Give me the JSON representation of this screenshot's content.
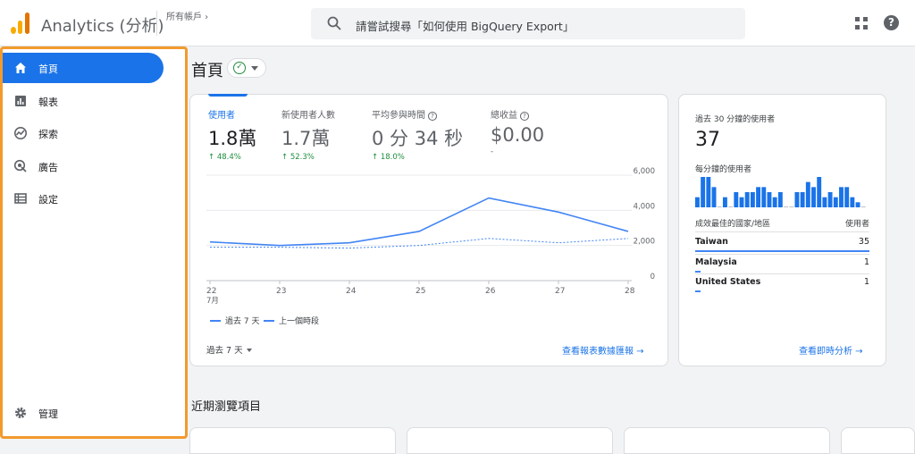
{
  "app": {
    "title": "Analytics (分析)",
    "account_breadcrumb": "所有帳戶 ›"
  },
  "search": {
    "placeholder": "請嘗試搜尋「如何使用 BigQuery Export」"
  },
  "sidebar": {
    "items": [
      {
        "label": "首頁",
        "icon": "home-icon",
        "active": true
      },
      {
        "label": "報表",
        "icon": "reports-icon",
        "active": false
      },
      {
        "label": "探索",
        "icon": "explore-icon",
        "active": false
      },
      {
        "label": "廣告",
        "icon": "advertising-icon",
        "active": false
      },
      {
        "label": "設定",
        "icon": "configure-icon",
        "active": false
      }
    ],
    "admin_label": "管理"
  },
  "page": {
    "title": "首頁",
    "recent_title": "近期瀏覽項目"
  },
  "metrics": [
    {
      "label": "使用者",
      "value": "1.8萬",
      "delta": "↑ 48.4%",
      "selected": true,
      "help": false
    },
    {
      "label": "新使用者人數",
      "value": "1.7萬",
      "delta": "↑ 52.3%",
      "selected": false,
      "help": false
    },
    {
      "label": "平均參與時間",
      "value": "0 分 34 秒",
      "delta": "↑ 18.0%",
      "selected": false,
      "help": true
    },
    {
      "label": "總收益",
      "value": "$0.00",
      "delta": "-",
      "selected": false,
      "help": true
    }
  ],
  "chart_data": {
    "type": "line",
    "categories": [
      "22",
      "23",
      "24",
      "25",
      "26",
      "27",
      "28"
    ],
    "x_month_label": "7月",
    "yticks": [
      "6,000",
      "4,000",
      "2,000",
      "0"
    ],
    "ylim": [
      0,
      6000
    ],
    "series": [
      {
        "name": "過去 7 天",
        "style": "solid",
        "values": [
          2200,
          2000,
          2150,
          2800,
          4700,
          3900,
          2800
        ]
      },
      {
        "name": "上一個時段",
        "style": "dashed",
        "values": [
          1900,
          1900,
          1850,
          2000,
          2400,
          2150,
          2400
        ]
      }
    ],
    "color": "#4285f4",
    "grid": true
  },
  "overview": {
    "period_label": "過去 7 天",
    "link_label": "查看報表數據匯報 →"
  },
  "realtime": {
    "title": "過去 30 分鐘的使用者",
    "value": "37",
    "per_minute_label": "每分鐘的使用者",
    "per_minute": [
      2,
      6,
      6,
      4,
      0,
      2,
      0,
      3,
      2,
      3,
      3,
      4,
      4,
      3,
      2,
      3,
      0,
      0,
      3,
      3,
      5,
      4,
      6,
      2,
      3,
      2,
      4,
      4,
      2,
      1,
      0
    ],
    "table_header_country": "成效最佳的國家/地區",
    "table_header_users": "使用者",
    "rows": [
      {
        "country": "Taiwan",
        "users": "35",
        "share": 1.0
      },
      {
        "country": "Malaysia",
        "users": "1",
        "share": 0.03
      },
      {
        "country": "United States",
        "users": "1",
        "share": 0.03
      }
    ],
    "link_label": "查看即時分析 →"
  }
}
